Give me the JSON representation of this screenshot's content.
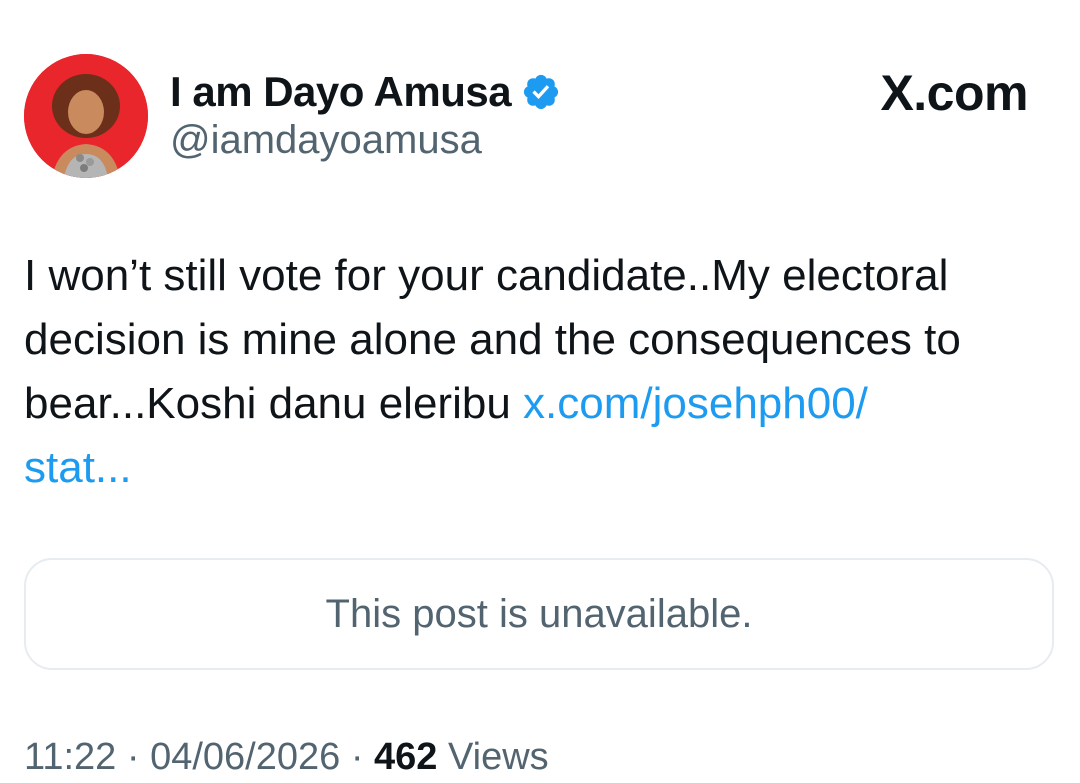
{
  "author": {
    "display_name": "I am Dayo Amusa",
    "handle": "@iamdayoamusa",
    "verified": true,
    "avatar_icon": "profile-photo"
  },
  "source": {
    "label": "X.com"
  },
  "tweet": {
    "text": "I won’t still vote for your candidate..My electoral decision is mine alone and the consequences to bear...Koshi danu eleribu ",
    "link_text": "x.com/josehph00/\nstat..."
  },
  "quoted_post": {
    "message": "This post is unavailable."
  },
  "meta": {
    "time": "11:22",
    "separator": "·",
    "date": "04/06/2026",
    "views_count": "462",
    "views_label": "Views"
  },
  "colors": {
    "link": "#1d9bf0",
    "verified_badge": "#1d9bf0",
    "secondary_text": "#536471",
    "primary_text": "#0f1419",
    "card_border": "#e6ecf0"
  }
}
